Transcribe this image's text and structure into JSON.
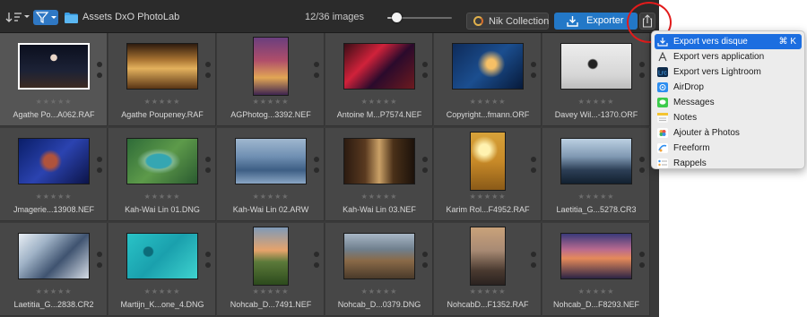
{
  "toolbar": {
    "sort_icon": "sort-icon",
    "filter_icon": "filter-funnel-icon",
    "folder_name": "Assets DxO PhotoLab",
    "image_count": "12/36 images",
    "zoom_level": 0.15,
    "nik_label": "Nik Collection",
    "export_label": "Exporter",
    "share_icon": "share-icon"
  },
  "thumbnails": [
    {
      "name": "Agathe Po...A062.RAF",
      "selected": true
    },
    {
      "name": "Agathe Poupeney.RAF"
    },
    {
      "name": "AGPhotog...3392.NEF"
    },
    {
      "name": "Antoine M...P7574.NEF"
    },
    {
      "name": "Copyright...fmann.ORF"
    },
    {
      "name": "Davey Wil...-1370.ORF"
    },
    {
      "name": "Jmagerie...13908.NEF"
    },
    {
      "name": "Kah-Wai Lin 01.DNG"
    },
    {
      "name": "Kah-Wai Lin 02.ARW"
    },
    {
      "name": "Kah-Wai Lin 03.NEF"
    },
    {
      "name": "Karim Rol...F4952.RAF"
    },
    {
      "name": "Laetitia_G...5278.CR3"
    },
    {
      "name": "Laetitia_G...2838.CR2"
    },
    {
      "name": "Martijn_K...one_4.DNG"
    },
    {
      "name": "Nohcab_D...7491.NEF"
    },
    {
      "name": "Nohcab_D...0379.DNG"
    },
    {
      "name": "NohcabD...F1352.RAF"
    },
    {
      "name": "Nohcab_D...F8293.NEF"
    }
  ],
  "rating_stars": "★★★★★",
  "share_menu": {
    "items": [
      {
        "label": "Export vers disque",
        "shortcut": "⌘ K",
        "icon": "export-disk-icon",
        "highlighted": true
      },
      {
        "label": "Export vers application",
        "icon": "application-icon"
      },
      {
        "label": "Export vers Lightroom",
        "icon": "lightroom-icon"
      },
      {
        "label": "AirDrop",
        "icon": "airdrop-icon"
      },
      {
        "label": "Messages",
        "icon": "messages-icon"
      },
      {
        "label": "Notes",
        "icon": "notes-icon"
      },
      {
        "label": "Ajouter à Photos",
        "icon": "photos-icon"
      },
      {
        "label": "Freeform",
        "icon": "freeform-icon"
      },
      {
        "label": "Rappels",
        "icon": "reminders-icon"
      }
    ]
  },
  "colors": {
    "accent": "#2378c7",
    "menu_highlight": "#1c6ee0",
    "annotation": "#e21b1b"
  }
}
